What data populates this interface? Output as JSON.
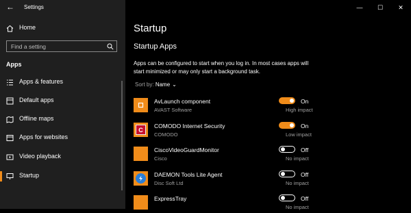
{
  "window": {
    "title": "Settings",
    "controls": [
      "—",
      "☐",
      "✕"
    ]
  },
  "sidebar": {
    "home_label": "Home",
    "search_placeholder": "Find a setting",
    "section_heading": "Apps",
    "items": [
      {
        "label": "Apps & features",
        "icon": "list-icon"
      },
      {
        "label": "Default apps",
        "icon": "default-apps-icon"
      },
      {
        "label": "Offline maps",
        "icon": "map-icon"
      },
      {
        "label": "Apps for websites",
        "icon": "web-apps-icon"
      },
      {
        "label": "Video playback",
        "icon": "video-icon"
      },
      {
        "label": "Startup",
        "icon": "startup-icon",
        "selected": true
      }
    ]
  },
  "main": {
    "page_title": "Startup",
    "section_title": "Startup Apps",
    "description": "Apps can be configured to start when you log in. In most cases apps will start minimized or may only start a background task.",
    "sort_label": "Sort by:",
    "sort_value": "Name",
    "apps": [
      {
        "name": "AvLaunch component",
        "publisher": "AVAST Software",
        "state": "On",
        "enabled": true,
        "impact": "High impact"
      },
      {
        "name": "COMODO Internet Security",
        "publisher": "COMODO",
        "state": "On",
        "enabled": true,
        "impact": "Low impact"
      },
      {
        "name": "CiscoVideoGuardMonitor",
        "publisher": "Cisco",
        "state": "Off",
        "enabled": false,
        "impact": "No impact"
      },
      {
        "name": "DAEMON Tools Lite Agent",
        "publisher": "Disc Soft Ltd",
        "state": "Off",
        "enabled": false,
        "impact": "No impact"
      },
      {
        "name": "ExpressTray",
        "publisher": "",
        "state": "Off",
        "enabled": false,
        "impact": "No impact"
      }
    ]
  },
  "colors": {
    "accent": "#f08c1a",
    "sidebar_bg": "#1f1f1f",
    "main_bg": "#000000",
    "secondary_text": "#a0a0a0"
  }
}
